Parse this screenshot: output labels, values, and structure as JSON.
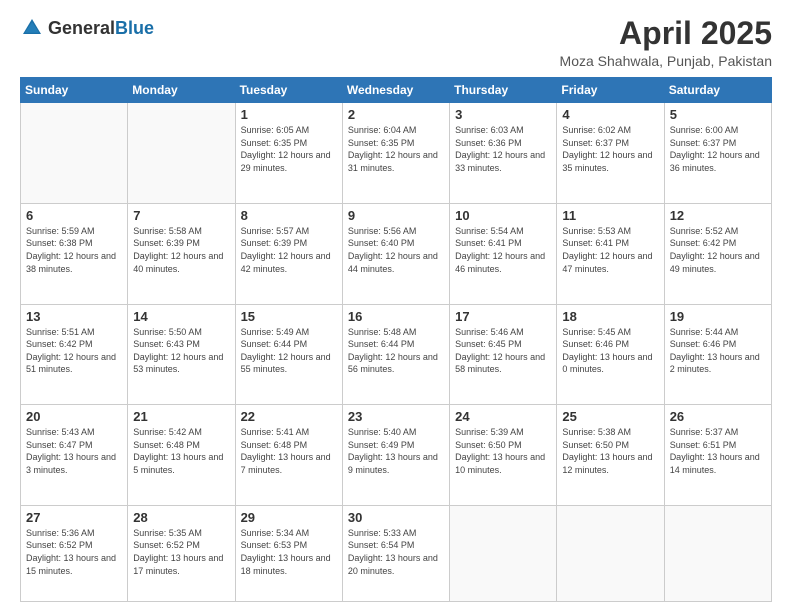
{
  "header": {
    "logo_general": "General",
    "logo_blue": "Blue",
    "title": "April 2025",
    "location": "Moza Shahwala, Punjab, Pakistan"
  },
  "days_of_week": [
    "Sunday",
    "Monday",
    "Tuesday",
    "Wednesday",
    "Thursday",
    "Friday",
    "Saturday"
  ],
  "weeks": [
    [
      {
        "day": "",
        "sunrise": "",
        "sunset": "",
        "daylight": ""
      },
      {
        "day": "",
        "sunrise": "",
        "sunset": "",
        "daylight": ""
      },
      {
        "day": "1",
        "sunrise": "Sunrise: 6:05 AM",
        "sunset": "Sunset: 6:35 PM",
        "daylight": "Daylight: 12 hours and 29 minutes."
      },
      {
        "day": "2",
        "sunrise": "Sunrise: 6:04 AM",
        "sunset": "Sunset: 6:35 PM",
        "daylight": "Daylight: 12 hours and 31 minutes."
      },
      {
        "day": "3",
        "sunrise": "Sunrise: 6:03 AM",
        "sunset": "Sunset: 6:36 PM",
        "daylight": "Daylight: 12 hours and 33 minutes."
      },
      {
        "day": "4",
        "sunrise": "Sunrise: 6:02 AM",
        "sunset": "Sunset: 6:37 PM",
        "daylight": "Daylight: 12 hours and 35 minutes."
      },
      {
        "day": "5",
        "sunrise": "Sunrise: 6:00 AM",
        "sunset": "Sunset: 6:37 PM",
        "daylight": "Daylight: 12 hours and 36 minutes."
      }
    ],
    [
      {
        "day": "6",
        "sunrise": "Sunrise: 5:59 AM",
        "sunset": "Sunset: 6:38 PM",
        "daylight": "Daylight: 12 hours and 38 minutes."
      },
      {
        "day": "7",
        "sunrise": "Sunrise: 5:58 AM",
        "sunset": "Sunset: 6:39 PM",
        "daylight": "Daylight: 12 hours and 40 minutes."
      },
      {
        "day": "8",
        "sunrise": "Sunrise: 5:57 AM",
        "sunset": "Sunset: 6:39 PM",
        "daylight": "Daylight: 12 hours and 42 minutes."
      },
      {
        "day": "9",
        "sunrise": "Sunrise: 5:56 AM",
        "sunset": "Sunset: 6:40 PM",
        "daylight": "Daylight: 12 hours and 44 minutes."
      },
      {
        "day": "10",
        "sunrise": "Sunrise: 5:54 AM",
        "sunset": "Sunset: 6:41 PM",
        "daylight": "Daylight: 12 hours and 46 minutes."
      },
      {
        "day": "11",
        "sunrise": "Sunrise: 5:53 AM",
        "sunset": "Sunset: 6:41 PM",
        "daylight": "Daylight: 12 hours and 47 minutes."
      },
      {
        "day": "12",
        "sunrise": "Sunrise: 5:52 AM",
        "sunset": "Sunset: 6:42 PM",
        "daylight": "Daylight: 12 hours and 49 minutes."
      }
    ],
    [
      {
        "day": "13",
        "sunrise": "Sunrise: 5:51 AM",
        "sunset": "Sunset: 6:42 PM",
        "daylight": "Daylight: 12 hours and 51 minutes."
      },
      {
        "day": "14",
        "sunrise": "Sunrise: 5:50 AM",
        "sunset": "Sunset: 6:43 PM",
        "daylight": "Daylight: 12 hours and 53 minutes."
      },
      {
        "day": "15",
        "sunrise": "Sunrise: 5:49 AM",
        "sunset": "Sunset: 6:44 PM",
        "daylight": "Daylight: 12 hours and 55 minutes."
      },
      {
        "day": "16",
        "sunrise": "Sunrise: 5:48 AM",
        "sunset": "Sunset: 6:44 PM",
        "daylight": "Daylight: 12 hours and 56 minutes."
      },
      {
        "day": "17",
        "sunrise": "Sunrise: 5:46 AM",
        "sunset": "Sunset: 6:45 PM",
        "daylight": "Daylight: 12 hours and 58 minutes."
      },
      {
        "day": "18",
        "sunrise": "Sunrise: 5:45 AM",
        "sunset": "Sunset: 6:46 PM",
        "daylight": "Daylight: 13 hours and 0 minutes."
      },
      {
        "day": "19",
        "sunrise": "Sunrise: 5:44 AM",
        "sunset": "Sunset: 6:46 PM",
        "daylight": "Daylight: 13 hours and 2 minutes."
      }
    ],
    [
      {
        "day": "20",
        "sunrise": "Sunrise: 5:43 AM",
        "sunset": "Sunset: 6:47 PM",
        "daylight": "Daylight: 13 hours and 3 minutes."
      },
      {
        "day": "21",
        "sunrise": "Sunrise: 5:42 AM",
        "sunset": "Sunset: 6:48 PM",
        "daylight": "Daylight: 13 hours and 5 minutes."
      },
      {
        "day": "22",
        "sunrise": "Sunrise: 5:41 AM",
        "sunset": "Sunset: 6:48 PM",
        "daylight": "Daylight: 13 hours and 7 minutes."
      },
      {
        "day": "23",
        "sunrise": "Sunrise: 5:40 AM",
        "sunset": "Sunset: 6:49 PM",
        "daylight": "Daylight: 13 hours and 9 minutes."
      },
      {
        "day": "24",
        "sunrise": "Sunrise: 5:39 AM",
        "sunset": "Sunset: 6:50 PM",
        "daylight": "Daylight: 13 hours and 10 minutes."
      },
      {
        "day": "25",
        "sunrise": "Sunrise: 5:38 AM",
        "sunset": "Sunset: 6:50 PM",
        "daylight": "Daylight: 13 hours and 12 minutes."
      },
      {
        "day": "26",
        "sunrise": "Sunrise: 5:37 AM",
        "sunset": "Sunset: 6:51 PM",
        "daylight": "Daylight: 13 hours and 14 minutes."
      }
    ],
    [
      {
        "day": "27",
        "sunrise": "Sunrise: 5:36 AM",
        "sunset": "Sunset: 6:52 PM",
        "daylight": "Daylight: 13 hours and 15 minutes."
      },
      {
        "day": "28",
        "sunrise": "Sunrise: 5:35 AM",
        "sunset": "Sunset: 6:52 PM",
        "daylight": "Daylight: 13 hours and 17 minutes."
      },
      {
        "day": "29",
        "sunrise": "Sunrise: 5:34 AM",
        "sunset": "Sunset: 6:53 PM",
        "daylight": "Daylight: 13 hours and 18 minutes."
      },
      {
        "day": "30",
        "sunrise": "Sunrise: 5:33 AM",
        "sunset": "Sunset: 6:54 PM",
        "daylight": "Daylight: 13 hours and 20 minutes."
      },
      {
        "day": "",
        "sunrise": "",
        "sunset": "",
        "daylight": ""
      },
      {
        "day": "",
        "sunrise": "",
        "sunset": "",
        "daylight": ""
      },
      {
        "day": "",
        "sunrise": "",
        "sunset": "",
        "daylight": ""
      }
    ]
  ]
}
